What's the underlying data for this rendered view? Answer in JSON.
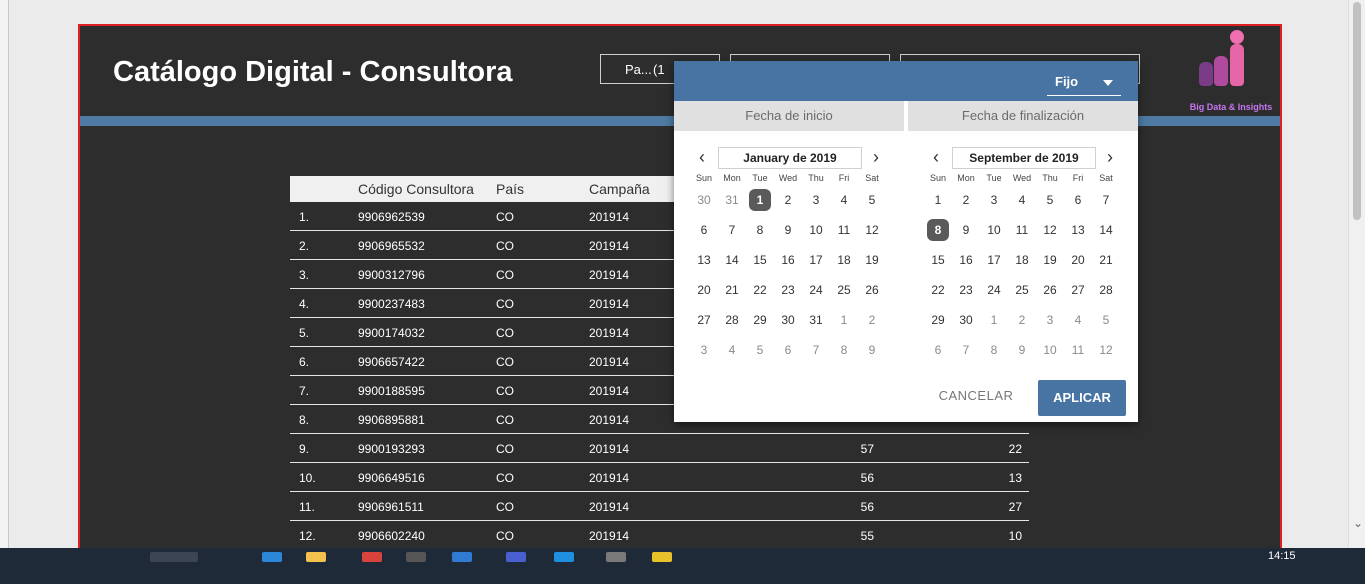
{
  "report": {
    "title": "Catálogo Digital - Consultora",
    "filters": [
      {
        "label": "Pa...",
        "extra": "(1"
      },
      {
        "label": ""
      },
      {
        "label": ""
      }
    ],
    "logo": {
      "caption": "Big Data & Insights"
    }
  },
  "table": {
    "headers": {
      "code": "Código Consultora",
      "pais": "País",
      "campana": "Campaña"
    },
    "rows": [
      {
        "idx": "1.",
        "code": "9906962539",
        "pais": "CO",
        "campana": "201914",
        "v1": "",
        "v2": ""
      },
      {
        "idx": "2.",
        "code": "9906965532",
        "pais": "CO",
        "campana": "201914",
        "v1": "",
        "v2": ""
      },
      {
        "idx": "3.",
        "code": "9900312796",
        "pais": "CO",
        "campana": "201914",
        "v1": "",
        "v2": ""
      },
      {
        "idx": "4.",
        "code": "9900237483",
        "pais": "CO",
        "campana": "201914",
        "v1": "",
        "v2": ""
      },
      {
        "idx": "5.",
        "code": "9900174032",
        "pais": "CO",
        "campana": "201914",
        "v1": "",
        "v2": ""
      },
      {
        "idx": "6.",
        "code": "9906657422",
        "pais": "CO",
        "campana": "201914",
        "v1": "",
        "v2": ""
      },
      {
        "idx": "7.",
        "code": "9900188595",
        "pais": "CO",
        "campana": "201914",
        "v1": "",
        "v2": ""
      },
      {
        "idx": "8.",
        "code": "9906895881",
        "pais": "CO",
        "campana": "201914",
        "v1": "",
        "v2": ""
      },
      {
        "idx": "9.",
        "code": "9900193293",
        "pais": "CO",
        "campana": "201914",
        "v1": "57",
        "v2": "22"
      },
      {
        "idx": "10.",
        "code": "9906649516",
        "pais": "CO",
        "campana": "201914",
        "v1": "56",
        "v2": "13"
      },
      {
        "idx": "11.",
        "code": "9906961511",
        "pais": "CO",
        "campana": "201914",
        "v1": "56",
        "v2": "27"
      },
      {
        "idx": "12.",
        "code": "9906602240",
        "pais": "CO",
        "campana": "201914",
        "v1": "55",
        "v2": "10"
      }
    ]
  },
  "datepicker": {
    "mode": "Fijo",
    "tab_start": "Fecha de inicio",
    "tab_end": "Fecha de finalización",
    "dow": [
      "Sun",
      "Mon",
      "Tue",
      "Wed",
      "Thu",
      "Fri",
      "Sat"
    ],
    "start": {
      "month": "January de 2019",
      "weeks": [
        [
          "30",
          "31",
          "1",
          "2",
          "3",
          "4",
          "5"
        ],
        [
          "6",
          "7",
          "8",
          "9",
          "10",
          "11",
          "12"
        ],
        [
          "13",
          "14",
          "15",
          "16",
          "17",
          "18",
          "19"
        ],
        [
          "20",
          "21",
          "22",
          "23",
          "24",
          "25",
          "26"
        ],
        [
          "27",
          "28",
          "29",
          "30",
          "31",
          "1",
          "2"
        ],
        [
          "3",
          "4",
          "5",
          "6",
          "7",
          "8",
          "9"
        ]
      ],
      "selected": "1"
    },
    "end": {
      "month": "September de 2019",
      "weeks": [
        [
          "1",
          "2",
          "3",
          "4",
          "5",
          "6",
          "7"
        ],
        [
          "8",
          "9",
          "10",
          "11",
          "12",
          "13",
          "14"
        ],
        [
          "15",
          "16",
          "17",
          "18",
          "19",
          "20",
          "21"
        ],
        [
          "22",
          "23",
          "24",
          "25",
          "26",
          "27",
          "28"
        ],
        [
          "29",
          "30",
          "1",
          "2",
          "3",
          "4",
          "5"
        ],
        [
          "6",
          "7",
          "8",
          "9",
          "10",
          "11",
          "12"
        ]
      ],
      "selected": "8"
    },
    "cancel_label": "CANCELAR",
    "apply_label": "APLICAR"
  },
  "taskbar": {
    "clock": "14:15"
  },
  "colors": {
    "accent": "#4874a4",
    "report_bg": "#2d2d2d",
    "frame": "#e02020",
    "logo": "#c775f0"
  }
}
